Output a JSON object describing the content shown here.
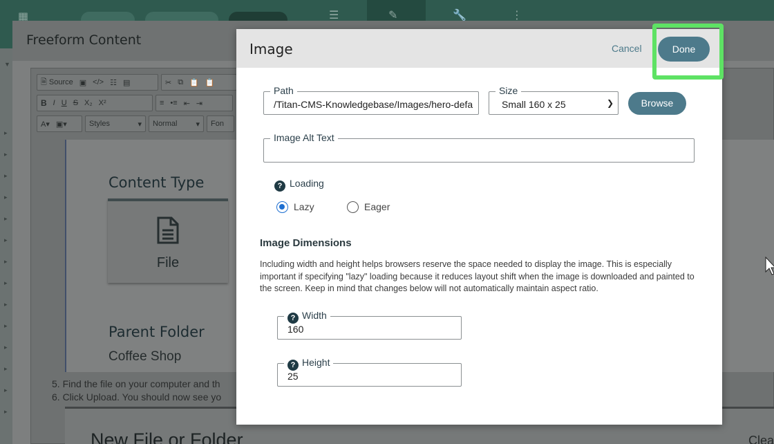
{
  "background": {
    "panel_title": "Freeform Content",
    "toolbar": {
      "source_label": "Source",
      "styles_label": "Styles",
      "format_label": "Normal",
      "font_label": "Fon"
    },
    "content_type_heading": "Content Type",
    "file_label": "File",
    "parent_folder_heading": "Parent Folder",
    "parent_folder_value": "Coffee Shop",
    "steps": [
      "5. Find the file on your computer and th",
      "6. Click Upload. You should now see yo"
    ],
    "new_box_title": "New File or Folder",
    "new_box_clear": "Clea"
  },
  "modal": {
    "title": "Image",
    "cancel_label": "Cancel",
    "done_label": "Done",
    "path": {
      "label": "Path",
      "value": "/Titan-CMS-Knowledgebase/Images/hero-defa"
    },
    "size": {
      "label": "Size",
      "selected": "Small 160 x 25"
    },
    "browse_label": "Browse",
    "alt_text": {
      "label": "Image Alt Text",
      "value": ""
    },
    "loading": {
      "label": "Loading",
      "options": [
        "Lazy",
        "Eager"
      ],
      "selected": "Lazy"
    },
    "dimensions": {
      "title": "Image Dimensions",
      "description": "Including width and height helps browsers reserve the space needed to display the image. This is especially important if specifying \"lazy\" loading because it reduces layout shift when the image is downloaded and painted to the screen. Keep in mind that changes below will not automatically maintain aspect ratio.",
      "width_label": "Width",
      "width_value": "160",
      "height_label": "Height",
      "height_value": "25"
    }
  },
  "colors": {
    "accent": "#4d7a8b",
    "highlight": "#5ee264",
    "radio_selected": "#1d6fd1"
  }
}
